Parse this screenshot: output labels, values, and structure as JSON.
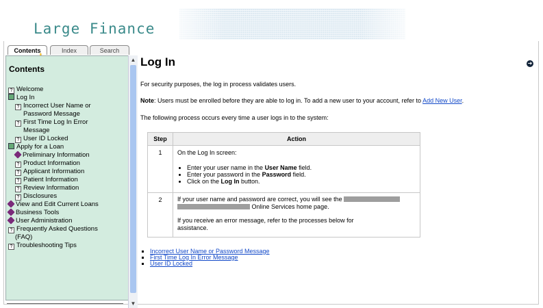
{
  "header": {
    "brand": "Large Finance"
  },
  "tabs": [
    {
      "label": "Contents",
      "active": true
    },
    {
      "label": "Index",
      "active": false
    },
    {
      "label": "Search",
      "active": false
    }
  ],
  "sidebar": {
    "title": "Contents",
    "items": [
      {
        "label": "Welcome",
        "icon": "page-icon",
        "level": 0
      },
      {
        "label": "Log In",
        "icon": "book-icon",
        "level": 0
      },
      {
        "label": "Incorrect User Name or",
        "icon": "page-icon",
        "level": 1
      },
      {
        "label": "Password Message",
        "icon": "",
        "level": 2
      },
      {
        "label": "First Time Log In Error",
        "icon": "page-icon",
        "level": 1
      },
      {
        "label": "Message",
        "icon": "",
        "level": 2
      },
      {
        "label": "User ID Locked",
        "icon": "page-icon",
        "level": 1
      },
      {
        "label": "Apply for a Loan",
        "icon": "book-icon",
        "level": 0
      },
      {
        "label": "Preliminary Information",
        "icon": "diamond-icon",
        "level": 1
      },
      {
        "label": "Product Information",
        "icon": "page-icon",
        "level": 1
      },
      {
        "label": "Applicant Information",
        "icon": "page-icon",
        "level": 1
      },
      {
        "label": "Patient Information",
        "icon": "page-icon",
        "level": 1
      },
      {
        "label": "Review Information",
        "icon": "page-icon",
        "level": 1
      },
      {
        "label": "Disclosures",
        "icon": "page-icon",
        "level": 1
      },
      {
        "label": "View and Edit Current Loans",
        "icon": "diamond-icon",
        "level": 0
      },
      {
        "label": "Business Tools",
        "icon": "diamond-icon",
        "level": 0
      },
      {
        "label": "User Administration",
        "icon": "diamond-icon",
        "level": 0
      },
      {
        "label": "Frequently Asked Questions",
        "icon": "page-icon",
        "level": 0
      },
      {
        "label": "(FAQ)",
        "icon": "",
        "level": 1
      },
      {
        "label": "Troubleshooting Tips",
        "icon": "page-icon",
        "level": 0
      }
    ]
  },
  "main": {
    "title": "Log In",
    "intro": "For security purposes, the log in process validates users.",
    "note_label": "Note",
    "note_text": ": Users must be enrolled before they are able to log in. To add a new user to your account, refer to ",
    "note_link": "Add New User",
    "note_end": ".",
    "process_text": "The following process occurs every time a user logs in to the system:",
    "table": {
      "col_step": "Step",
      "col_action": "Action",
      "row1_step": "1",
      "row1_intro": "On the Log In screen:",
      "row1_b1_pre": "Enter your user name in the ",
      "row1_b1_bold": "User Name",
      "row1_b1_post": " field.",
      "row1_b2_pre": "Enter your password in the ",
      "row1_b2_bold": "Password",
      "row1_b2_post": " field.",
      "row1_b3_pre": "Click on the ",
      "row1_b3_bold": "Log In",
      "row1_b3_post": " button.",
      "row2_step": "2",
      "row2_line1": "If your user name and password are correct, you will see the",
      "row2_line2": "Online Services home page.",
      "row2_line3": "If you receive an error message, refer to the processes below for",
      "row2_line4": "assistance."
    },
    "related_links": [
      "Incorrect User Name or Password Message",
      "First Time Log In Error Message",
      "User ID Locked"
    ]
  },
  "colors": {
    "sidebar_bg": "#d3ecdf",
    "brand": "#3a8a8a",
    "link": "#1148c8",
    "scroll_thumb": "#a9c6f0"
  }
}
